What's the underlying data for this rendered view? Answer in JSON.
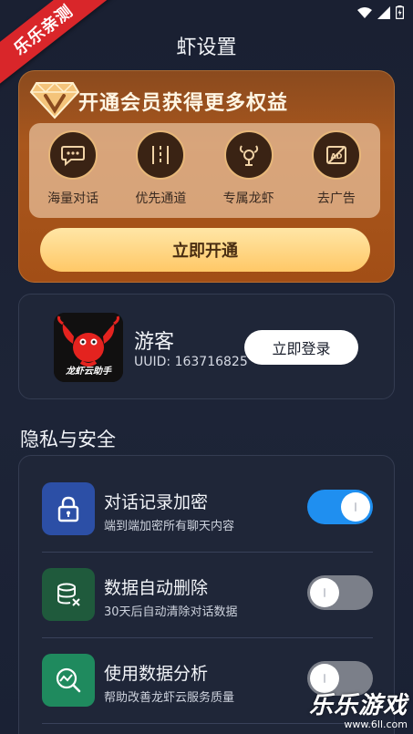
{
  "ribbon": {
    "label": "乐乐亲测"
  },
  "header": {
    "title": "虾设置"
  },
  "vip": {
    "title": "开通会员获得更多权益",
    "perks": [
      {
        "label": "海量对话",
        "icon": "chat-bubble-icon"
      },
      {
        "label": "优先通道",
        "icon": "lanes-icon"
      },
      {
        "label": "专属龙虾",
        "icon": "lobster-icon"
      },
      {
        "label": "去广告",
        "icon": "no-ads-icon"
      }
    ],
    "button_label": "立即开通"
  },
  "user": {
    "avatar_caption": "龙虾云助手",
    "name": "游客",
    "uuid": "UUID: 163716825",
    "login_label": "立即登录"
  },
  "privacy": {
    "section_title": "隐私与安全",
    "items": [
      {
        "title": "对话记录加密",
        "desc": "端到端加密所有聊天内容",
        "icon": "lock-icon",
        "icon_bg": "#2c4fa6",
        "enabled": true
      },
      {
        "title": "数据自动删除",
        "desc": "30天后自动清除对话数据",
        "icon": "database-delete-icon",
        "icon_bg": "#1f5a3c",
        "enabled": false
      },
      {
        "title": "使用数据分析",
        "desc": "帮助改善龙虾云服务质量",
        "icon": "analytics-search-icon",
        "icon_bg": "#1f8a5e",
        "enabled": false
      }
    ]
  },
  "watermark": {
    "main": "乐乐游戏",
    "url": "www.6ll.com"
  },
  "colors": {
    "accent": "#1f8ff0",
    "vip_gold": "#ffc867",
    "background": "#1a2032"
  }
}
